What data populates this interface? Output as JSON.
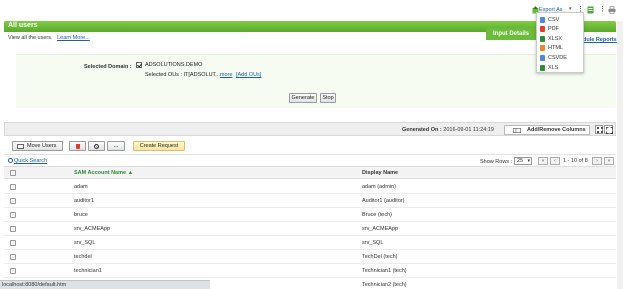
{
  "page": {
    "title": "All users",
    "description": "View all the users.",
    "learn_more": "Learn More..."
  },
  "header": {
    "export_label": "Export As",
    "input_details_tab": "Input Details",
    "schedule_link": "dule Reports"
  },
  "export_menu": {
    "items": [
      {
        "label": "CSV",
        "color": "#4a8ad8"
      },
      {
        "label": "PDF",
        "color": "#d9412c"
      },
      {
        "label": "XLSX",
        "color": "#2f8a3c"
      },
      {
        "label": "HTML",
        "color": "#e8862b"
      },
      {
        "label": "CSVDE",
        "color": "#4a8ad8"
      },
      {
        "label": "XLS",
        "color": "#2f8a3c"
      }
    ]
  },
  "form": {
    "domain_label": "Selected Domain :",
    "domain_value": "ADSOLUTIONS.DEMO",
    "ous_text": "Selected OUs : IT[ADSOLUT...",
    "ous_more": "more",
    "ous_add": "[Add OUs]",
    "generate_button": "Generate",
    "stop_button": "Stop"
  },
  "grid": {
    "generated_label": "Generated On :",
    "generated_value": "2016-09-01 11:24:19",
    "add_remove_columns": "Add/Remove Columns",
    "move_users": "Move Users",
    "more_button": "...",
    "create_request": "Create Request",
    "quick_search": "Quick Search",
    "show_rows_label": "Show Rows :",
    "show_rows_value": "25",
    "page_info": "1 - 10 of 8",
    "columns": {
      "sam": "SAM Account Name",
      "display": "Display Name"
    },
    "rows": [
      {
        "sam": "adam",
        "display": "adam (admin)"
      },
      {
        "sam": "auditor1",
        "display": "Auditor1 (auditor)"
      },
      {
        "sam": "bruce",
        "display": "Bruce (tech)"
      },
      {
        "sam": "srv_ACMEApp",
        "display": "srv_ACMEApp"
      },
      {
        "sam": "srv_SQL",
        "display": "srv_SQL"
      },
      {
        "sam": "techdel",
        "display": "TechDel (tech)"
      },
      {
        "sam": "technician1",
        "display": "Technician1 (tech)"
      },
      {
        "sam": "",
        "display": "Technician2 (tech)"
      }
    ]
  },
  "statusbar": {
    "url": "localhost:8080/default.htm"
  },
  "colors": {
    "accent_green": "#6cbb3a",
    "link_blue": "#1f5fa8",
    "delete_red": "#e03b2f"
  }
}
